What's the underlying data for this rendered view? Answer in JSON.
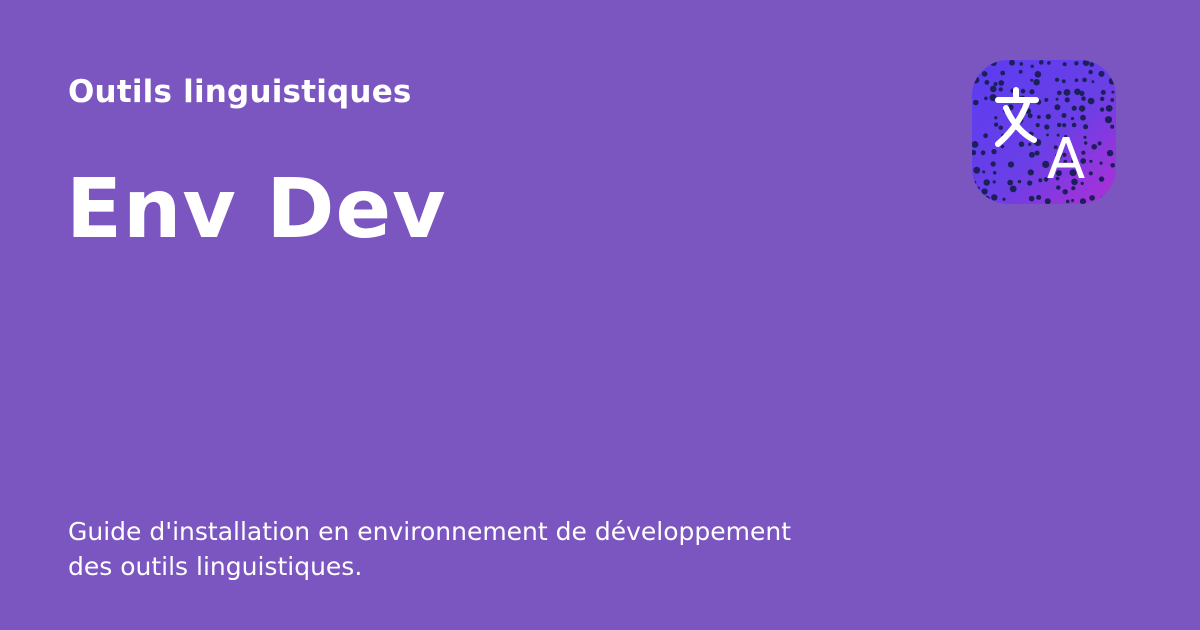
{
  "header": {
    "kicker": "Outils linguistiques",
    "title": "Env Dev"
  },
  "description": {
    "line1": "Guide d'installation en environnement de développement",
    "line2": "des outils linguistiques."
  },
  "logo": {
    "icon": "translate-icon",
    "glyph_a": "A"
  },
  "colors": {
    "background": "#7b55c0",
    "text": "#ffffff",
    "logo_gradient_start": "#5b3cf2",
    "logo_gradient_end": "#b02fd6",
    "logo_dots": "#1b1f5a"
  }
}
